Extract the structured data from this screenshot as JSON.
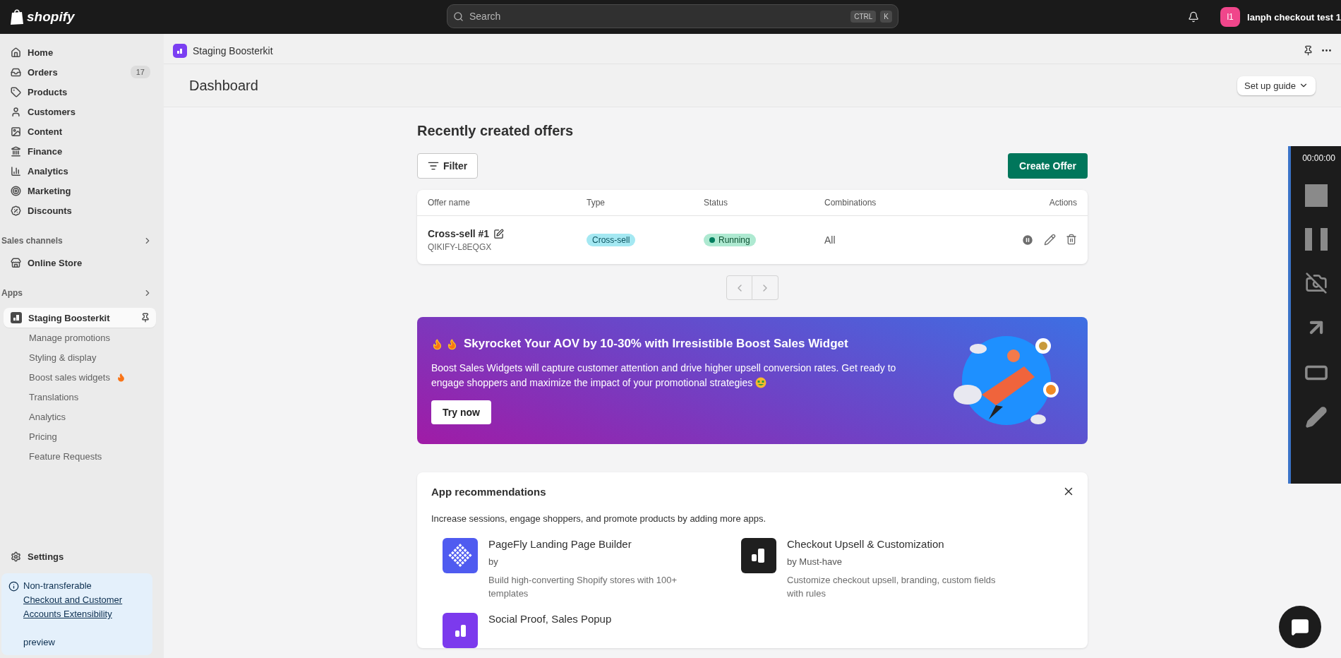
{
  "topbar": {
    "logo": "shopify",
    "search": {
      "placeholder": "Search",
      "keys": [
        "CTRL",
        "K"
      ]
    },
    "store": {
      "initials": "l1",
      "name": "lanph checkout test 1"
    }
  },
  "sidebar": {
    "nav": [
      {
        "label": "Home",
        "selected": false
      },
      {
        "label": "Orders",
        "badge": "17",
        "selected": false
      },
      {
        "label": "Products",
        "selected": false
      },
      {
        "label": "Customers",
        "selected": false
      },
      {
        "label": "Content",
        "selected": false
      },
      {
        "label": "Finance",
        "selected": false
      },
      {
        "label": "Analytics",
        "selected": false
      },
      {
        "label": "Marketing",
        "selected": false
      },
      {
        "label": "Discounts",
        "selected": false
      }
    ],
    "sales_channels": {
      "title": "Sales channels",
      "items": [
        {
          "label": "Online Store",
          "selected": false
        }
      ]
    },
    "apps": {
      "title": "Apps",
      "app": {
        "label": "Staging Boosterkit",
        "selected": true
      },
      "items": [
        {
          "label": "Manage promotions",
          "selected": false
        },
        {
          "label": "Styling & display",
          "selected": false
        },
        {
          "label": "Boost sales widgets",
          "hot": true,
          "selected": false
        },
        {
          "label": "Translations",
          "selected": false
        },
        {
          "label": "Analytics",
          "selected": false
        },
        {
          "label": "Pricing",
          "selected": false
        },
        {
          "label": "Feature Requests",
          "selected": false
        }
      ]
    },
    "settings": {
      "label": "Settings",
      "selected": false
    },
    "notice": {
      "title": "Non-transferable",
      "link": "Checkout and Customer Accounts Extensibility",
      "tail": "preview"
    }
  },
  "app_header": {
    "title": "Staging Boosterkit"
  },
  "page": {
    "title": "Dashboard",
    "guide_button": "Set up guide"
  },
  "offers": {
    "title": "Recently created offers",
    "filter_button": "Filter",
    "create_button": "Create Offer",
    "columns": [
      "Offer name",
      "Type",
      "Status",
      "Combinations",
      "Actions"
    ],
    "rows": [
      {
        "name": "Cross-sell #1",
        "code": "QIKIFY-L8EQGX",
        "type": {
          "label": "Cross-sell",
          "kind": "info"
        },
        "status": {
          "label": "Running",
          "kind": "success"
        },
        "combinations": "All"
      }
    ]
  },
  "banner": {
    "title": "Skyrocket Your AOV by 10-30% with Irresistible Boost Sales Widget",
    "text": "Boost Sales Widgets will capture customer attention and drive higher upsell conversion rates. Get ready to engage shoppers and maximize the impact of your promotional strategies",
    "button": "Try now"
  },
  "recommendations": {
    "title": "App recommendations",
    "description": "Increase sessions, engage shoppers, and promote products by adding more apps.",
    "apps": [
      {
        "kind": "grid",
        "name": "PageFly Landing Page Builder",
        "by": "by",
        "description": "Build high-converting Shopify stores with 100+ templates"
      },
      {
        "kind": "dark",
        "name": "Checkout Upsell & Customization",
        "by": "by Must-have",
        "description": "Customize checkout upsell, branding, custom fields with rules"
      },
      {
        "kind": "purple",
        "name": "Social Proof, Sales Popup"
      }
    ]
  },
  "recorder": {
    "time": "00:00:00"
  }
}
